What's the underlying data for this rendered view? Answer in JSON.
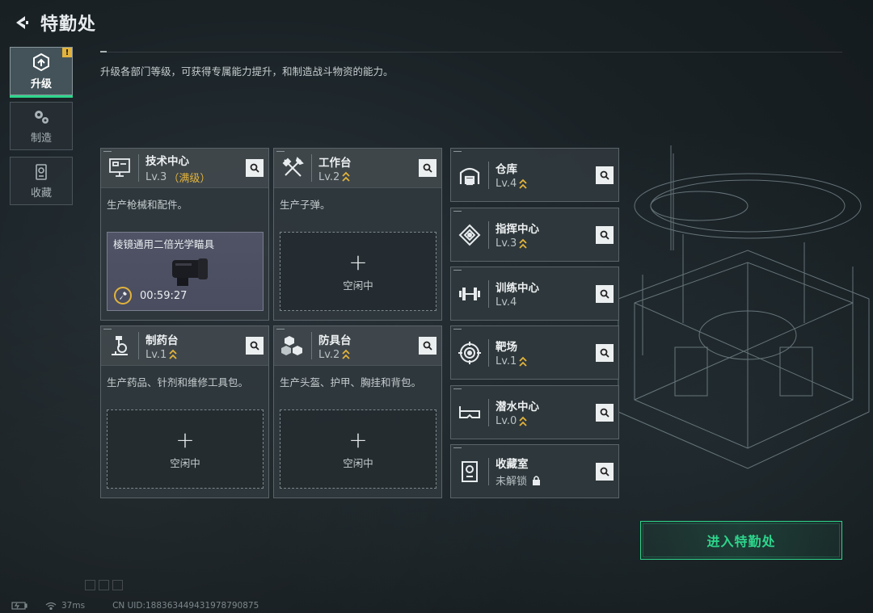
{
  "header": {
    "title": "特勤处"
  },
  "tabs": [
    {
      "label": "升级",
      "icon": "upgrade-icon",
      "active": true,
      "alert": "!"
    },
    {
      "label": "制造",
      "icon": "gear-cluster-icon",
      "active": false
    },
    {
      "label": "收藏",
      "icon": "collection-icon",
      "active": false
    }
  ],
  "description": "升级各部门等级，可获得专属能力提升，和制造战斗物资的能力。",
  "stations": [
    {
      "name": "技术中心",
      "level": "Lv.3",
      "maxed": "（满级）",
      "icon": "computer-icon",
      "desc": "生产枪械和配件。",
      "craft": {
        "item": "棱镜通用二倍光学瞄具",
        "timer": "00:59:27"
      }
    },
    {
      "name": "工作台",
      "level": "Lv.2",
      "icon": "tools-icon",
      "desc": "生产子弹。",
      "slot": {
        "plus": "+",
        "status": "空闲中"
      }
    },
    {
      "name": "制药台",
      "level": "Lv.1",
      "icon": "microscope-icon",
      "desc": "生产药品、针剂和维修工具包。",
      "slot": {
        "plus": "+",
        "status": "空闲中"
      }
    },
    {
      "name": "防具台",
      "level": "Lv.2",
      "icon": "cubes-icon",
      "desc": "生产头盔、护甲、胸挂和背包。",
      "slot": {
        "plus": "+",
        "status": "空闲中"
      }
    }
  ],
  "facilities": [
    {
      "name": "仓库",
      "level": "Lv.4",
      "icon": "warehouse-icon",
      "upgradable": true
    },
    {
      "name": "指挥中心",
      "level": "Lv.3",
      "icon": "command-icon",
      "upgradable": true
    },
    {
      "name": "训练中心",
      "level": "Lv.4",
      "icon": "dumbbell-icon",
      "upgradable": false
    },
    {
      "name": "靶场",
      "level": "Lv.1",
      "icon": "target-icon",
      "upgradable": true
    },
    {
      "name": "潜水中心",
      "level": "Lv.0",
      "icon": "diving-goggles-icon",
      "upgradable": true
    },
    {
      "name": "收藏室",
      "level": "未解锁",
      "icon": "vault-icon",
      "locked": true
    }
  ],
  "enter_button": {
    "label": "进入特勤处"
  },
  "status_bar": {
    "ping": "37ms",
    "uid": "CN UID:1883634494319787908​75"
  },
  "colors": {
    "accent_green": "#2dd58c",
    "accent_gold": "#e2b33c"
  }
}
